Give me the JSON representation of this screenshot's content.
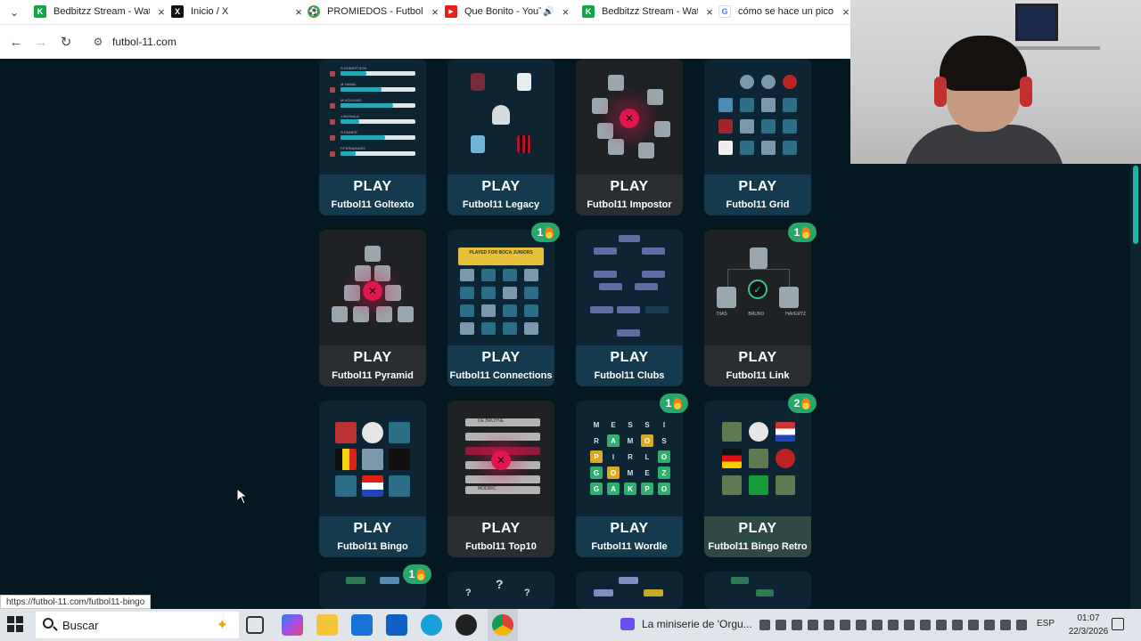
{
  "browser": {
    "tabs": [
      {
        "title": "Bedbitzz Stream - Wat",
        "favicon_color": "#17a34a",
        "favicon_glyph": "K"
      },
      {
        "title": "Inicio / X",
        "favicon_color": "#111111",
        "favicon_glyph": "X"
      },
      {
        "title": "PROMIEDOS - Futbol A",
        "favicon_color": "#3aa84a",
        "favicon_glyph": "⚽"
      },
      {
        "title": "Que Bonito - YouTu",
        "favicon_color": "#e62117",
        "favicon_glyph": "▶"
      },
      {
        "title": "Bedbitzz Stream - Wat",
        "favicon_color": "#17a34a",
        "favicon_glyph": "K"
      },
      {
        "title": "cómo se hace un pico",
        "favicon_color": "#4285f4",
        "favicon_glyph": "G"
      }
    ],
    "url": "futbol-11.com",
    "status_url": "https://futbol-11.com/futbol11-bingo"
  },
  "games": [
    {
      "play": "PLAY",
      "name": "Futbol11 Goltexto",
      "badge": null
    },
    {
      "play": "PLAY",
      "name": "Futbol11 Legacy",
      "badge": null
    },
    {
      "play": "PLAY",
      "name": "Futbol11 Impostor",
      "badge": null
    },
    {
      "play": "PLAY",
      "name": "Futbol11 Grid",
      "badge": null
    },
    {
      "play": "PLAY",
      "name": "Futbol11 Pyramid",
      "badge": null
    },
    {
      "play": "PLAY",
      "name": "Futbol11 Connections",
      "badge": "1"
    },
    {
      "play": "PLAY",
      "name": "Futbol11 Clubs",
      "badge": null
    },
    {
      "play": "PLAY",
      "name": "Futbol11 Link",
      "badge": "1"
    },
    {
      "play": "PLAY",
      "name": "Futbol11 Bingo",
      "badge": null
    },
    {
      "play": "PLAY",
      "name": "Futbol11 Top10",
      "badge": null
    },
    {
      "play": "PLAY",
      "name": "Futbol11 Wordle",
      "badge": "1"
    },
    {
      "play": "PLAY",
      "name": "Futbol11 Bingo Retro",
      "badge": "2"
    }
  ],
  "next_row_badges": [
    "1"
  ],
  "goltexto_art": {
    "rows": [
      "R.ROBERTSON",
      "M.YAMAL",
      "M.HOJLUND",
      "J.MUSIALA",
      "R.PAINER",
      "P.FERNANDES"
    ],
    "fills": [
      0.35,
      0.55,
      0.7,
      0.25,
      0.6,
      0.2
    ]
  },
  "connections_art": {
    "header": "PLAYED FOR BOCA JUNIORS"
  },
  "link_art": {
    "names": [
      "DIAS",
      "BRUNO",
      "HAVERTZ"
    ]
  },
  "top10_art": {
    "rows": [
      "DE BRUYNE",
      "",
      "",
      "",
      "MODRIC"
    ]
  },
  "wordle_art": {
    "grid": [
      [
        "M",
        "E",
        "S",
        "S",
        "I"
      ],
      [
        "R",
        "A",
        "M",
        "O",
        "S"
      ],
      [
        "P",
        "I",
        "R",
        "L",
        "O"
      ],
      [
        "G",
        "O",
        "M",
        "E",
        "Z"
      ],
      [
        "G",
        "A",
        "K",
        "P",
        "O"
      ]
    ],
    "states": [
      [
        "n",
        "n",
        "n",
        "n",
        "n"
      ],
      [
        "n",
        "g",
        "n",
        "y",
        "n"
      ],
      [
        "y",
        "n",
        "n",
        "n",
        "g"
      ],
      [
        "g",
        "y",
        "n",
        "n",
        "g"
      ],
      [
        "g",
        "g",
        "g",
        "g",
        "g"
      ]
    ]
  },
  "taskbar": {
    "search_placeholder": "Buscar",
    "media_title": "La miniserie de 'Orgu...",
    "language": "ESP",
    "time": "01:07",
    "date": "22/3/2026"
  },
  "colors": {
    "page_bg": "#041822",
    "card_footer": "#163a4d",
    "badge_green": "#27a86a",
    "accent_red": "#e0164d",
    "accent_teal": "#24a9b6"
  }
}
